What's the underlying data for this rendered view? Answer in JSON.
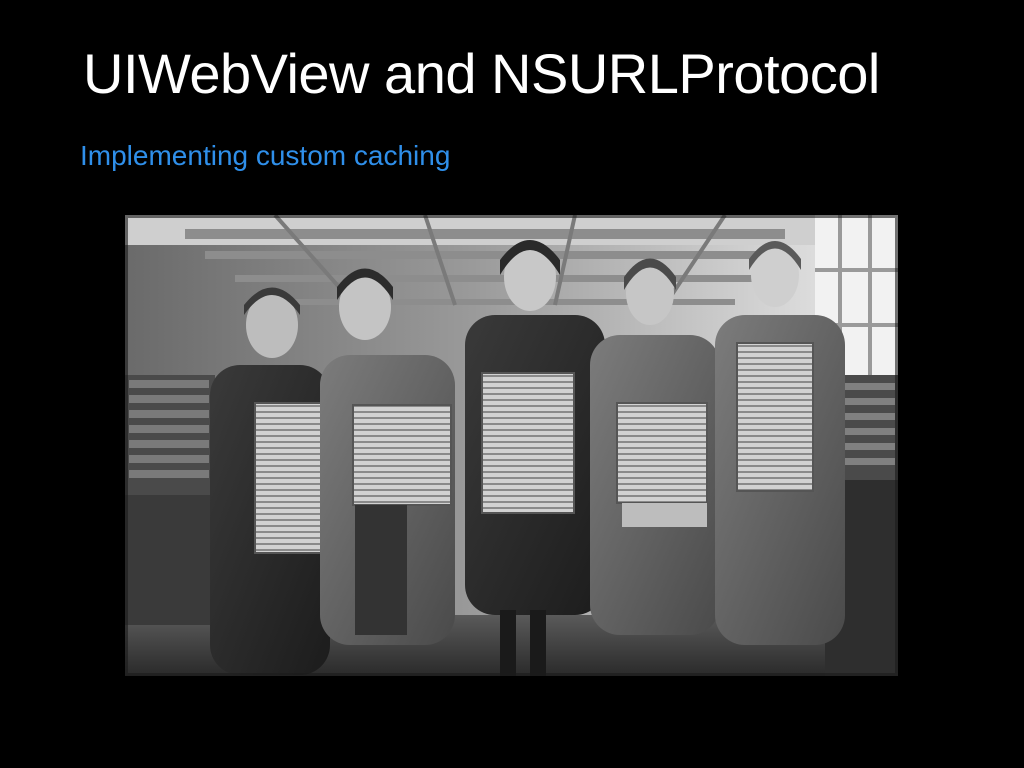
{
  "slide": {
    "title": "UIWebView and NSURLProtocol",
    "subtitle": "Implementing custom caching"
  },
  "colors": {
    "background": "#000000",
    "title": "#ffffff",
    "subtitle": "#2f8fea"
  },
  "photo": {
    "icon": "vintage-sepia-photograph"
  }
}
